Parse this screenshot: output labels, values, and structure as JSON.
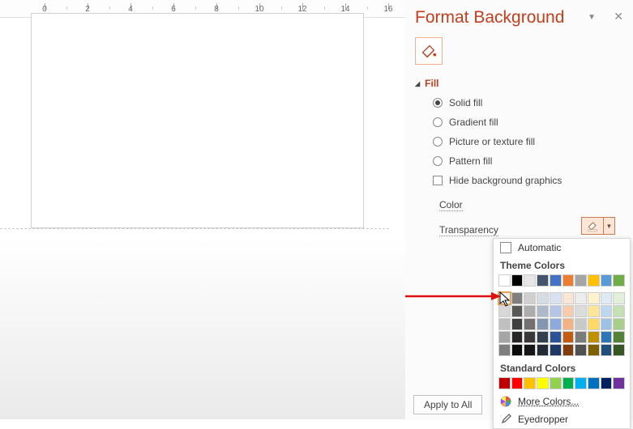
{
  "panel": {
    "title": "Format Background",
    "section": "Fill",
    "options": {
      "solid": "Solid fill",
      "gradient": "Gradient fill",
      "picture": "Picture or texture fill",
      "pattern": "Pattern fill",
      "hide": "Hide background graphics"
    },
    "color_label": "Color",
    "transparency_label": "Transparency",
    "apply_all": "Apply to All"
  },
  "picker": {
    "automatic": "Automatic",
    "theme_label": "Theme Colors",
    "standard_label": "Standard Colors",
    "more_colors": "More Colors...",
    "eyedropper": "Eyedropper",
    "theme_row1": [
      "#FFFFFF",
      "#000000",
      "#E7E6E6",
      "#44546A",
      "#4472C4",
      "#ED7D31",
      "#A5A5A5",
      "#FFC000",
      "#5B9BD5",
      "#70AD47"
    ],
    "theme_tints": [
      [
        "#F2F2F2",
        "#7F7F7F",
        "#D0CECE",
        "#D6DCE4",
        "#D9E2F3",
        "#FBE5D5",
        "#EDEDED",
        "#FFF2CC",
        "#DEEBF6",
        "#E2EFD9"
      ],
      [
        "#D8D8D8",
        "#595959",
        "#AEABAB",
        "#ADB9CA",
        "#B4C6E7",
        "#F7CBAC",
        "#DBDBDB",
        "#FEE599",
        "#BDD7EE",
        "#C5E0B3"
      ],
      [
        "#BFBFBF",
        "#3F3F3F",
        "#757070",
        "#8496B0",
        "#8EAADB",
        "#F4B183",
        "#C9C9C9",
        "#FFD965",
        "#9CC3E5",
        "#A8D08D"
      ],
      [
        "#A5A5A5",
        "#262626",
        "#3A3838",
        "#323F4F",
        "#2F5496",
        "#C55A11",
        "#7B7B7B",
        "#BF9000",
        "#2E75B5",
        "#538135"
      ],
      [
        "#7F7F7F",
        "#0C0C0C",
        "#171616",
        "#222A35",
        "#1F3864",
        "#833C0B",
        "#525252",
        "#7F6000",
        "#1E4E79",
        "#375623"
      ]
    ],
    "standard": [
      "#C00000",
      "#FF0000",
      "#FFC000",
      "#FFFF00",
      "#92D050",
      "#00B050",
      "#00B0F0",
      "#0070C0",
      "#002060",
      "#7030A0"
    ]
  },
  "ruler": {
    "labels": [
      "0",
      "2",
      "4",
      "6",
      "8",
      "10",
      "12",
      "14",
      "16"
    ]
  }
}
